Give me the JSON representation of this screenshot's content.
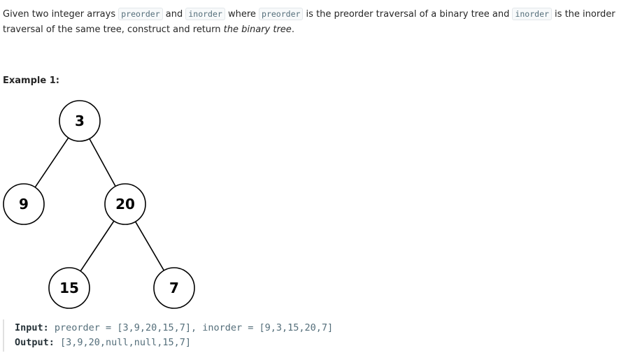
{
  "description": {
    "t1": "Given two integer arrays ",
    "code1": "preorder",
    "t2": " and ",
    "code2": "inorder",
    "t3": " where ",
    "code3": "preorder",
    "t4": " is the preorder traversal of a binary tree and ",
    "code4": "inorder",
    "t5": " is the inorder traversal of the same tree, construct and return ",
    "em": "the binary tree",
    "t6": "."
  },
  "example": {
    "title": "Example 1:",
    "input_label": "Input:",
    "input_value": " preorder = [3,9,20,15,7], inorder = [9,3,15,20,7]",
    "output_label": "Output:",
    "output_value": " [3,9,20,null,null,15,7]"
  },
  "tree": {
    "nodes": [
      {
        "id": "n3",
        "label": "3"
      },
      {
        "id": "n9",
        "label": "9"
      },
      {
        "id": "n20",
        "label": "20"
      },
      {
        "id": "n15",
        "label": "15"
      },
      {
        "id": "n7",
        "label": "7"
      }
    ],
    "edges": [
      [
        "n3",
        "n9"
      ],
      [
        "n3",
        "n20"
      ],
      [
        "n20",
        "n15"
      ],
      [
        "n20",
        "n7"
      ]
    ]
  }
}
